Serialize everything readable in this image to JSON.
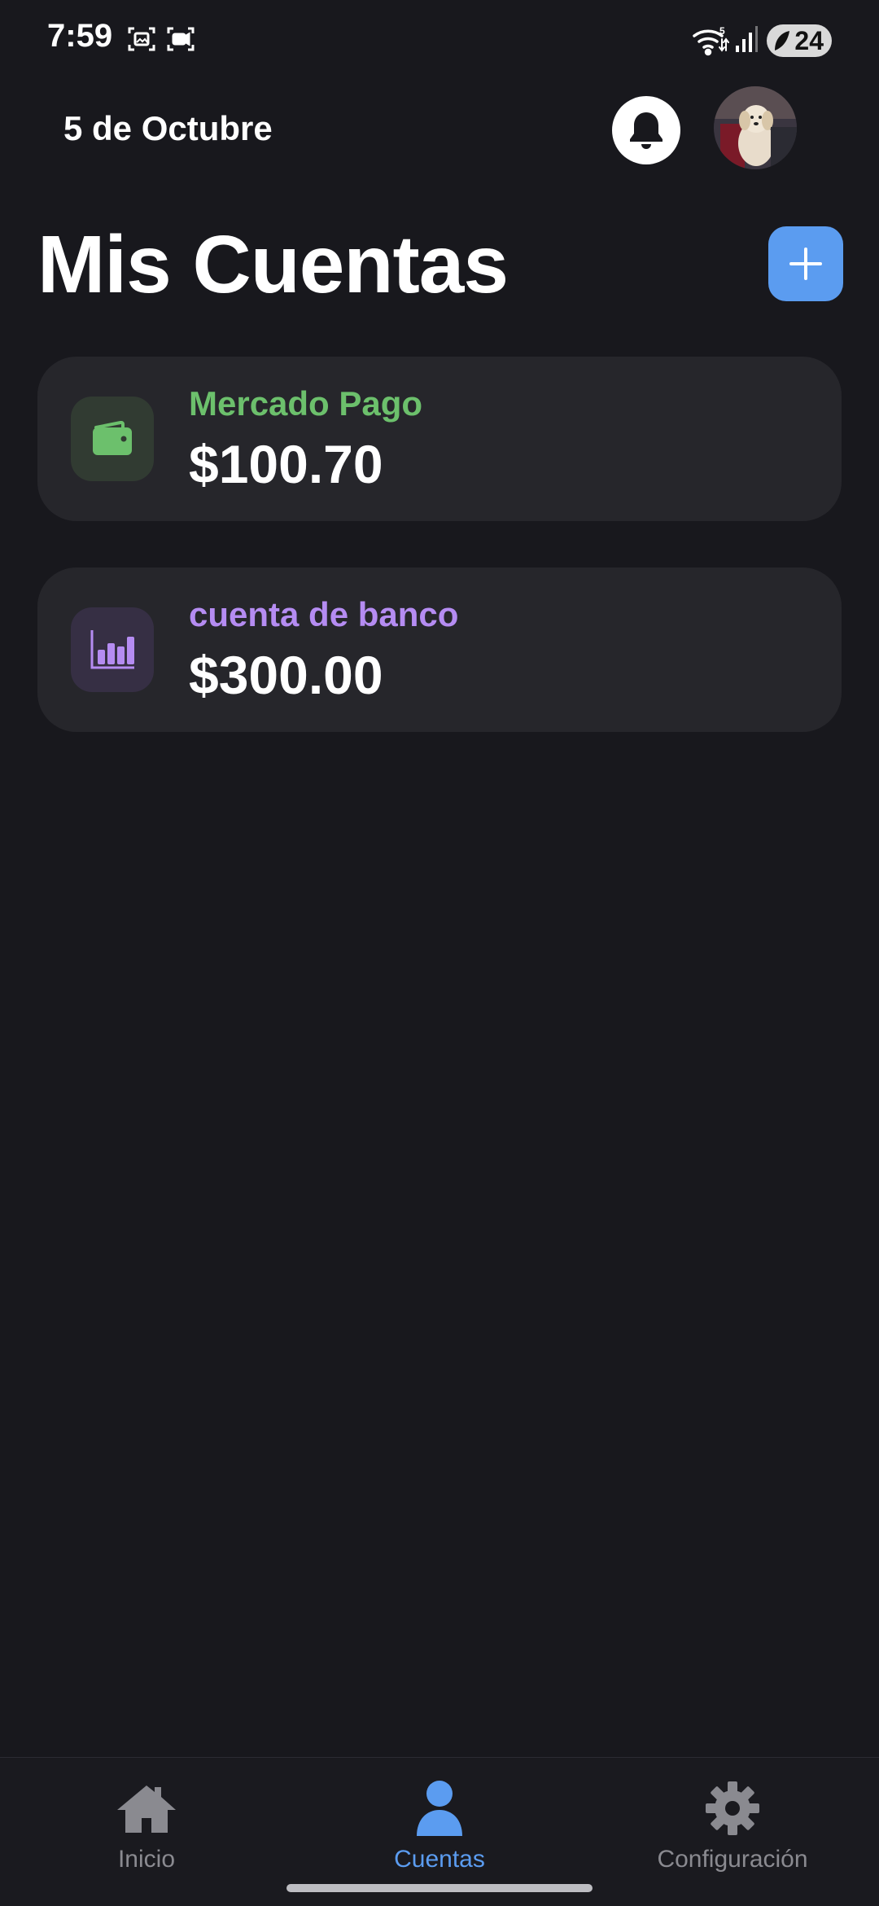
{
  "status_bar": {
    "time": "7:59",
    "battery": "24",
    "icons": [
      "screenshot-icon",
      "screen-record-icon",
      "wifi-icon",
      "signal-icon",
      "battery-icon"
    ]
  },
  "header": {
    "date": "5 de Octubre",
    "notification_icon": "bell-icon",
    "avatar": "profile-avatar"
  },
  "page": {
    "title": "Mis Cuentas",
    "add_icon": "plus-icon"
  },
  "accounts": [
    {
      "name": "Mercado Pago",
      "amount": "$100.70",
      "icon": "wallet-icon",
      "color": "#6cc06c"
    },
    {
      "name": "cuenta de banco",
      "amount": "$300.00",
      "icon": "bar-chart-icon",
      "color": "#b58cf2"
    }
  ],
  "bottom_nav": {
    "items": [
      {
        "label": "Inicio",
        "icon": "home-icon",
        "active": false
      },
      {
        "label": "Cuentas",
        "icon": "person-icon",
        "active": true
      },
      {
        "label": "Configuración",
        "icon": "gear-icon",
        "active": false
      }
    ],
    "active_color": "#5b9cf0"
  },
  "colors": {
    "background": "#18181d",
    "card": "#26262b",
    "accent": "#5b9cf0"
  }
}
